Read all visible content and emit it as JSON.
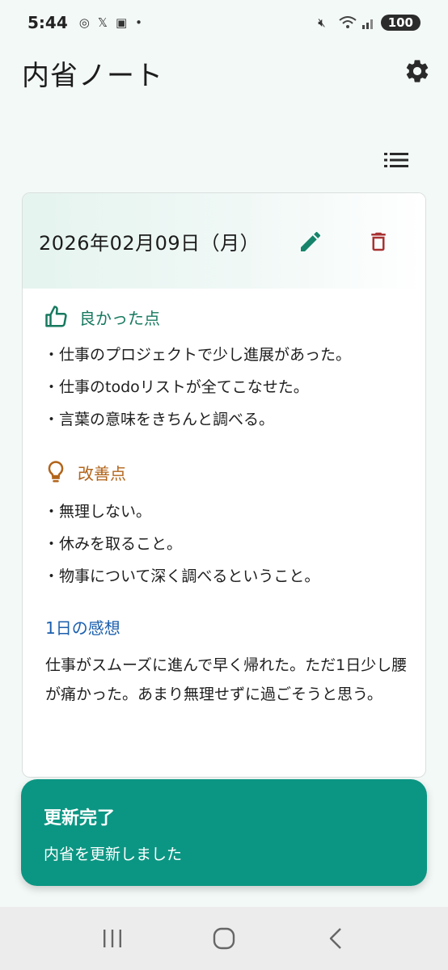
{
  "status_bar": {
    "time": "5:44",
    "battery": "100"
  },
  "app": {
    "title": "内省ノート"
  },
  "entry": {
    "date": "2026年02月09日（月）",
    "good": {
      "title": "良かった点",
      "items": [
        "・仕事のプロジェクトで少し進展があった。",
        "・仕事のtodoリストが全てこなせた。",
        "・言葉の意味をきちんと調べる。"
      ]
    },
    "improve": {
      "title": "改善点",
      "items": [
        "・無理しない。",
        "・休みを取ること。",
        "・物事について深く調べるということ。"
      ]
    },
    "impression": {
      "title": "1日の感想",
      "text": "仕事がスムーズに進んで早く帰れた。ただ1日少し腰が痛かった。あまり無理せずに過ごそうと思う。"
    }
  },
  "snackbar": {
    "title": "更新完了",
    "message": "内省を更新しました"
  },
  "colors": {
    "accent": "#0b9683",
    "good": "#17795f",
    "improve": "#b2641a",
    "impression": "#1b5fae",
    "delete": "#a83232",
    "edit": "#17846b"
  },
  "icons": {
    "settings": "gear-icon",
    "list": "list-icon",
    "edit": "pencil-icon",
    "delete": "trash-icon",
    "good": "thumb-up-icon",
    "improve": "lightbulb-icon"
  }
}
